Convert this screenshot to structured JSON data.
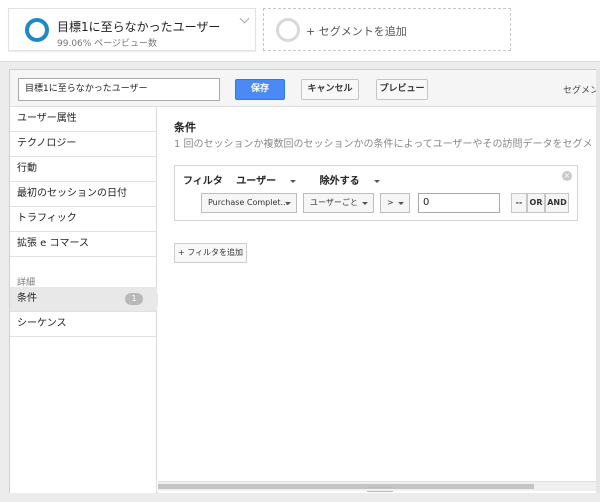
{
  "segment_bar": {
    "active_segment": {
      "title": "目標1に至らなかったユーザー",
      "subtitle": "99.06% ページビュー数"
    },
    "add_segment_label": "+ セグメントを追加"
  },
  "toolbar": {
    "segment_name_value": "目標1に至らなかったユーザー",
    "save_label": "保存",
    "cancel_label": "キャンセル",
    "preview_label": "プレビュー",
    "right_label": "セグメント"
  },
  "sidebar": {
    "items": [
      {
        "label": "ユーザー属性"
      },
      {
        "label": "テクノロジー"
      },
      {
        "label": "行動"
      },
      {
        "label": "最初のセッションの日付"
      },
      {
        "label": "トラフィック"
      },
      {
        "label": "拡張 e コマース"
      }
    ],
    "advanced_heading": "詳細",
    "advanced_items": [
      {
        "label": "条件",
        "badge": "1"
      },
      {
        "label": "シーケンス"
      }
    ]
  },
  "main": {
    "section_title": "条件",
    "section_desc": "1 回のセッションか複数回のセッションかの条件によってユーザーやその訪問データをセグメ",
    "filter": {
      "filter_label": "フィルタ",
      "scope_label": "ユーザー",
      "mode_label": "除外する",
      "metric_select": "Purchase Complet...",
      "per_select": "ユーザーごと",
      "operator_select": ">",
      "value": "0",
      "remove_label": "--",
      "or_label": "OR",
      "and_label": "AND",
      "close_glyph": "×"
    },
    "add_filter_label": "+ フィルタを追加"
  },
  "colors": {
    "accent": "#4a8af4",
    "ring": "#1e88c8"
  }
}
